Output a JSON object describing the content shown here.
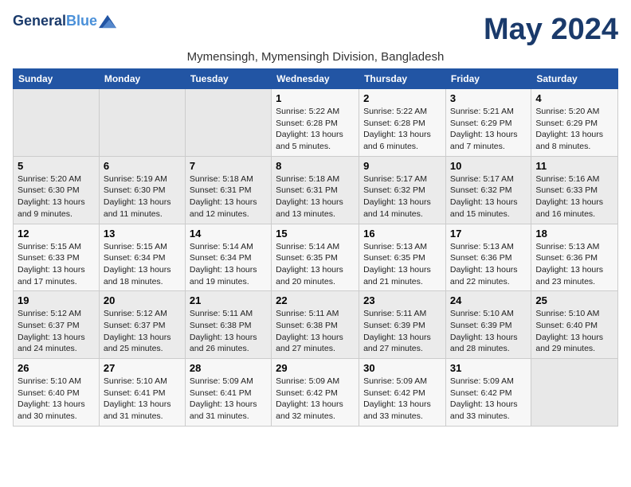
{
  "header": {
    "logo_line1": "General",
    "logo_line2": "Blue",
    "title": "May 2024",
    "subtitle": "Mymensingh, Mymensingh Division, Bangladesh"
  },
  "days_of_week": [
    "Sunday",
    "Monday",
    "Tuesday",
    "Wednesday",
    "Thursday",
    "Friday",
    "Saturday"
  ],
  "weeks": [
    [
      {
        "day": "",
        "detail": ""
      },
      {
        "day": "",
        "detail": ""
      },
      {
        "day": "",
        "detail": ""
      },
      {
        "day": "1",
        "detail": "Sunrise: 5:22 AM\nSunset: 6:28 PM\nDaylight: 13 hours\nand 5 minutes."
      },
      {
        "day": "2",
        "detail": "Sunrise: 5:22 AM\nSunset: 6:28 PM\nDaylight: 13 hours\nand 6 minutes."
      },
      {
        "day": "3",
        "detail": "Sunrise: 5:21 AM\nSunset: 6:29 PM\nDaylight: 13 hours\nand 7 minutes."
      },
      {
        "day": "4",
        "detail": "Sunrise: 5:20 AM\nSunset: 6:29 PM\nDaylight: 13 hours\nand 8 minutes."
      }
    ],
    [
      {
        "day": "5",
        "detail": "Sunrise: 5:20 AM\nSunset: 6:30 PM\nDaylight: 13 hours\nand 9 minutes."
      },
      {
        "day": "6",
        "detail": "Sunrise: 5:19 AM\nSunset: 6:30 PM\nDaylight: 13 hours\nand 11 minutes."
      },
      {
        "day": "7",
        "detail": "Sunrise: 5:18 AM\nSunset: 6:31 PM\nDaylight: 13 hours\nand 12 minutes."
      },
      {
        "day": "8",
        "detail": "Sunrise: 5:18 AM\nSunset: 6:31 PM\nDaylight: 13 hours\nand 13 minutes."
      },
      {
        "day": "9",
        "detail": "Sunrise: 5:17 AM\nSunset: 6:32 PM\nDaylight: 13 hours\nand 14 minutes."
      },
      {
        "day": "10",
        "detail": "Sunrise: 5:17 AM\nSunset: 6:32 PM\nDaylight: 13 hours\nand 15 minutes."
      },
      {
        "day": "11",
        "detail": "Sunrise: 5:16 AM\nSunset: 6:33 PM\nDaylight: 13 hours\nand 16 minutes."
      }
    ],
    [
      {
        "day": "12",
        "detail": "Sunrise: 5:15 AM\nSunset: 6:33 PM\nDaylight: 13 hours\nand 17 minutes."
      },
      {
        "day": "13",
        "detail": "Sunrise: 5:15 AM\nSunset: 6:34 PM\nDaylight: 13 hours\nand 18 minutes."
      },
      {
        "day": "14",
        "detail": "Sunrise: 5:14 AM\nSunset: 6:34 PM\nDaylight: 13 hours\nand 19 minutes."
      },
      {
        "day": "15",
        "detail": "Sunrise: 5:14 AM\nSunset: 6:35 PM\nDaylight: 13 hours\nand 20 minutes."
      },
      {
        "day": "16",
        "detail": "Sunrise: 5:13 AM\nSunset: 6:35 PM\nDaylight: 13 hours\nand 21 minutes."
      },
      {
        "day": "17",
        "detail": "Sunrise: 5:13 AM\nSunset: 6:36 PM\nDaylight: 13 hours\nand 22 minutes."
      },
      {
        "day": "18",
        "detail": "Sunrise: 5:13 AM\nSunset: 6:36 PM\nDaylight: 13 hours\nand 23 minutes."
      }
    ],
    [
      {
        "day": "19",
        "detail": "Sunrise: 5:12 AM\nSunset: 6:37 PM\nDaylight: 13 hours\nand 24 minutes."
      },
      {
        "day": "20",
        "detail": "Sunrise: 5:12 AM\nSunset: 6:37 PM\nDaylight: 13 hours\nand 25 minutes."
      },
      {
        "day": "21",
        "detail": "Sunrise: 5:11 AM\nSunset: 6:38 PM\nDaylight: 13 hours\nand 26 minutes."
      },
      {
        "day": "22",
        "detail": "Sunrise: 5:11 AM\nSunset: 6:38 PM\nDaylight: 13 hours\nand 27 minutes."
      },
      {
        "day": "23",
        "detail": "Sunrise: 5:11 AM\nSunset: 6:39 PM\nDaylight: 13 hours\nand 27 minutes."
      },
      {
        "day": "24",
        "detail": "Sunrise: 5:10 AM\nSunset: 6:39 PM\nDaylight: 13 hours\nand 28 minutes."
      },
      {
        "day": "25",
        "detail": "Sunrise: 5:10 AM\nSunset: 6:40 PM\nDaylight: 13 hours\nand 29 minutes."
      }
    ],
    [
      {
        "day": "26",
        "detail": "Sunrise: 5:10 AM\nSunset: 6:40 PM\nDaylight: 13 hours\nand 30 minutes."
      },
      {
        "day": "27",
        "detail": "Sunrise: 5:10 AM\nSunset: 6:41 PM\nDaylight: 13 hours\nand 31 minutes."
      },
      {
        "day": "28",
        "detail": "Sunrise: 5:09 AM\nSunset: 6:41 PM\nDaylight: 13 hours\nand 31 minutes."
      },
      {
        "day": "29",
        "detail": "Sunrise: 5:09 AM\nSunset: 6:42 PM\nDaylight: 13 hours\nand 32 minutes."
      },
      {
        "day": "30",
        "detail": "Sunrise: 5:09 AM\nSunset: 6:42 PM\nDaylight: 13 hours\nand 33 minutes."
      },
      {
        "day": "31",
        "detail": "Sunrise: 5:09 AM\nSunset: 6:42 PM\nDaylight: 13 hours\nand 33 minutes."
      },
      {
        "day": "",
        "detail": ""
      }
    ]
  ]
}
